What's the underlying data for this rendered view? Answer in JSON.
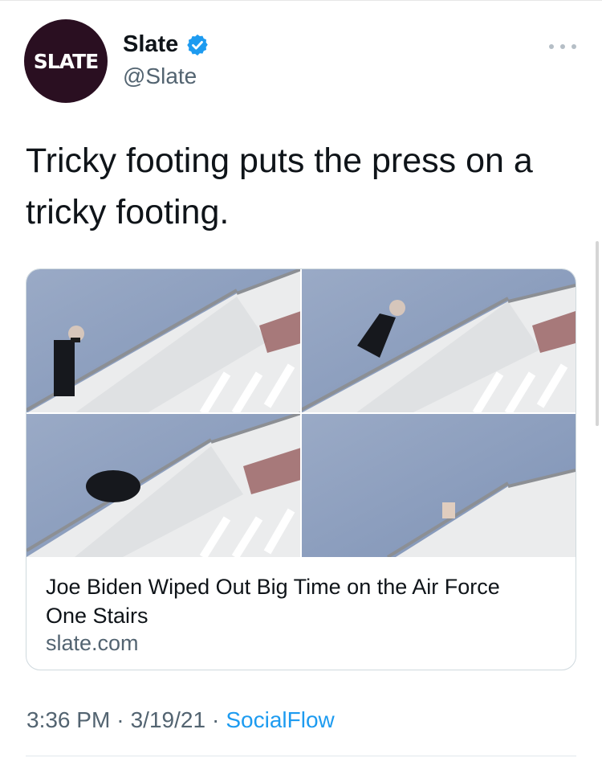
{
  "tweet": {
    "author": {
      "avatar_text": "SLATE",
      "name": "Slate",
      "handle": "@Slate",
      "verified": true
    },
    "text": "Tricky footing puts the press on a tricky footing.",
    "card": {
      "image_icon": "photo-collage",
      "title": "Joe Biden Wiped Out Big Time on the Air Force One Stairs",
      "domain": "slate.com"
    },
    "meta": {
      "time": "3:36 PM",
      "date": "3/19/21",
      "source": "SocialFlow"
    }
  },
  "colors": {
    "avatar_bg": "#2a0f21",
    "verified_blue": "#1d9bf0",
    "link_blue": "#1d9bf0",
    "muted_text": "#536471",
    "sky": "#8fa2c0"
  }
}
